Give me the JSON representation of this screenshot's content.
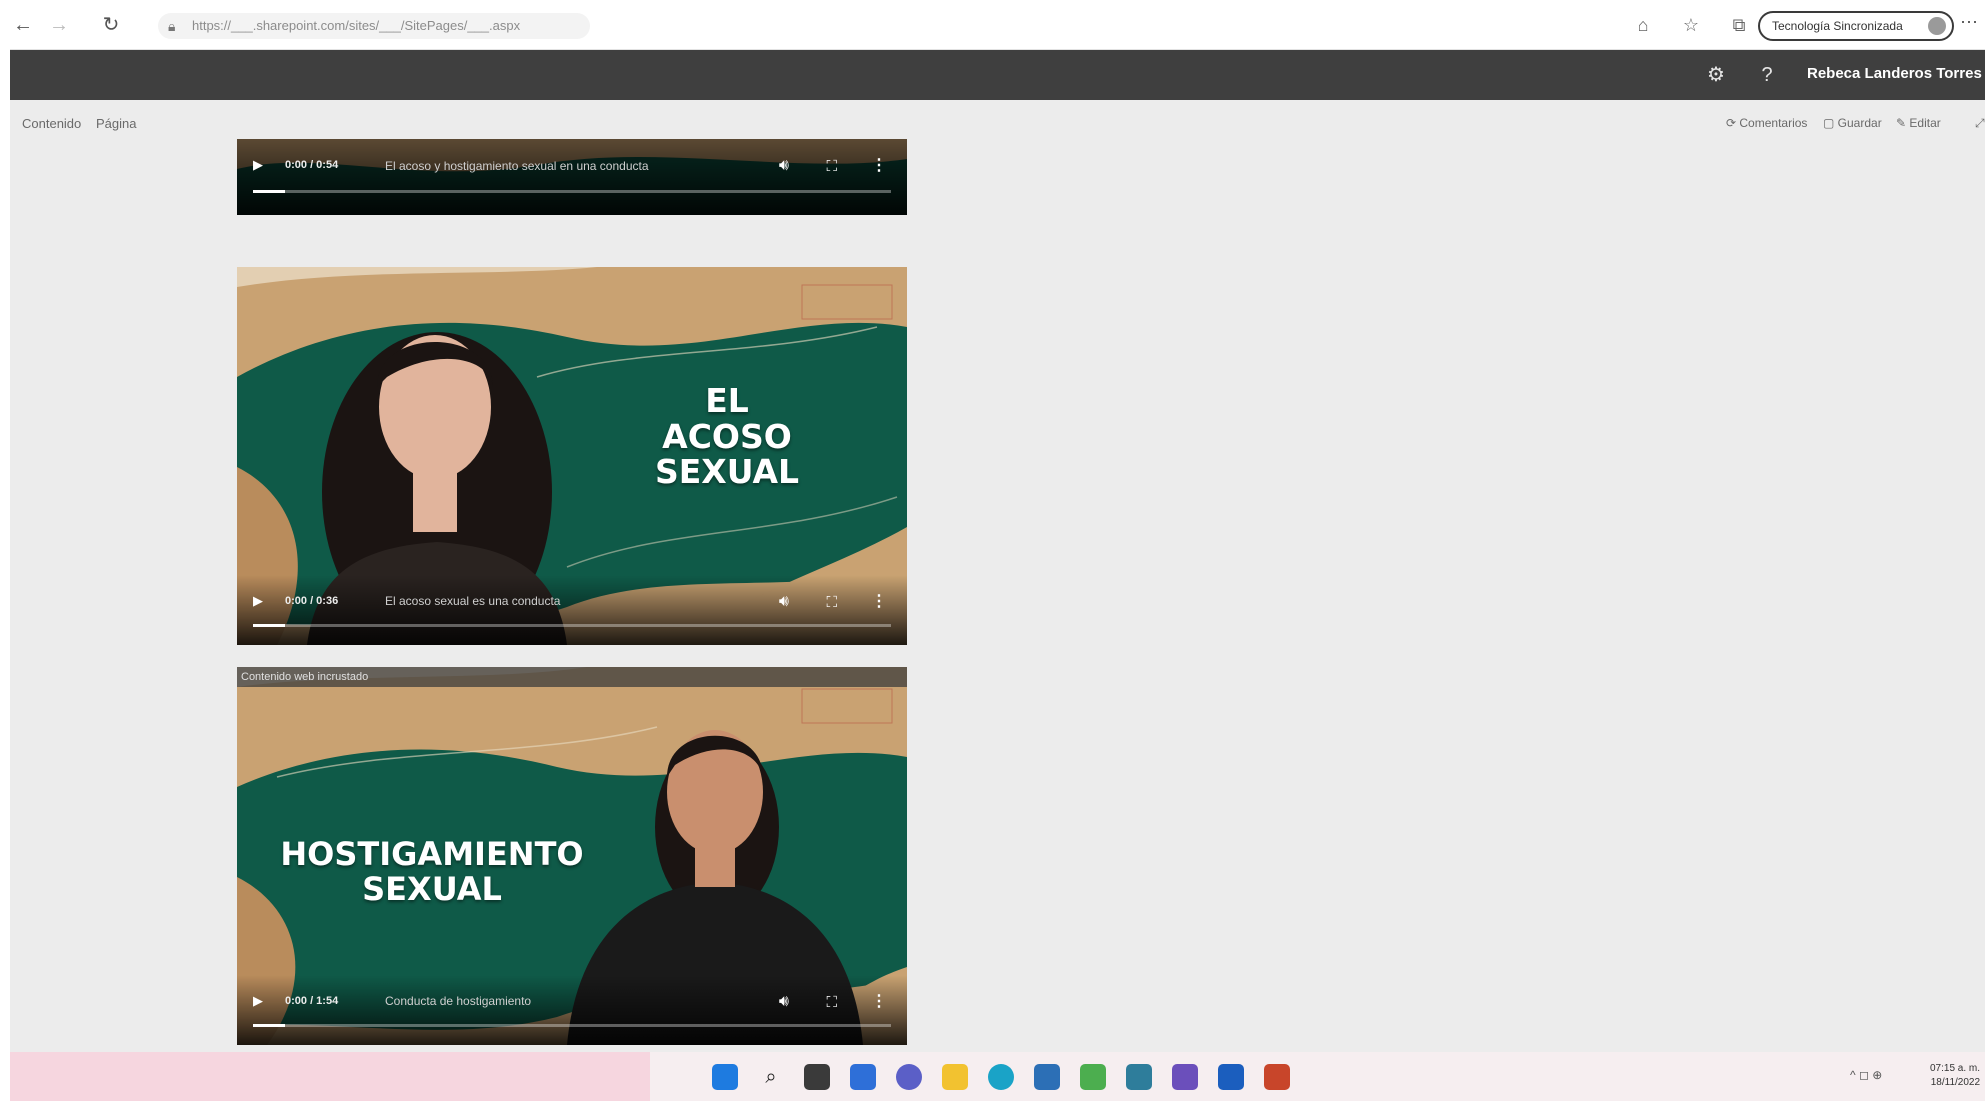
{
  "browser": {
    "back_glyph": "←",
    "forward_glyph": "→",
    "reload_glyph": "↻",
    "address": "https://___.sharepoint.com/sites/___/SitePages/___.aspx",
    "profile_label": "Tecnología Sincronizada"
  },
  "app_header": {
    "settings_glyph": "⚙",
    "help_glyph": "?",
    "user_name": "Rebeca Landeros Torres"
  },
  "command_bar": {
    "crumbs": [
      "Contenido",
      "Página"
    ],
    "actions": [
      "Comentarios",
      "Guardar",
      "Editar"
    ]
  },
  "videos": [
    {
      "title_lines": [],
      "time": "0:00 / 0:54",
      "caption": "El acoso y hostigamiento sexual en una conducta",
      "progress": 0.05
    },
    {
      "title_lines": [
        "EL",
        "ACOSO",
        "SEXUAL"
      ],
      "time": "0:00 / 0:36",
      "caption": "El acoso sexual es una conducta",
      "progress": 0.05
    },
    {
      "title_lines": [
        "HOSTIGAMIENTO",
        "SEXUAL"
      ],
      "time": "0:00 / 1:54",
      "caption": "Conducta de hostigamiento",
      "progress": 0.05,
      "source_label": "Contenido web incrustado"
    }
  ],
  "taskbar": {
    "tray_text": "^  ◻  ⊕",
    "clock_time": "07:15 a. m.",
    "clock_date": "18/11/2022"
  },
  "colors": {
    "header_bg": "#3f3f3f",
    "video_green": "#0f5a48",
    "video_tan": "#c9a272"
  }
}
